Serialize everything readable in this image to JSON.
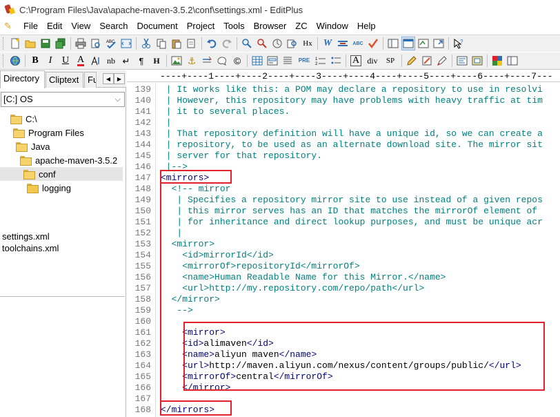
{
  "window": {
    "title": "C:\\Program Files\\Java\\apache-maven-3.5.2\\conf\\settings.xml - EditPlus"
  },
  "menu": [
    "File",
    "Edit",
    "View",
    "Search",
    "Document",
    "Project",
    "Tools",
    "Browser",
    "ZC",
    "Window",
    "Help"
  ],
  "toolbar2": {
    "bold": "B",
    "italic": "I",
    "underline": "U",
    "font_color": "A",
    "nbsp": "nb",
    "break": "↵",
    "paragraph": "¶",
    "heading": "H",
    "anchor": "⚓",
    "copyright": "©",
    "pre": "PRE",
    "a_tag": "A",
    "div": "div",
    "span": "SP"
  },
  "toolbar1": {
    "hex": "Hx",
    "abc": "ABC",
    "word_wrap": "W"
  },
  "left_panel": {
    "tabs": [
      "Directory",
      "Cliptext",
      "Fu"
    ],
    "drive": "[C:] OS",
    "tree": [
      "C:\\",
      "Program Files",
      "Java",
      "apache-maven-3.5.2",
      "conf",
      "logging"
    ],
    "selected_folder": "conf",
    "files": [
      "settings.xml",
      "toolchains.xml"
    ]
  },
  "editor": {
    "ruler": "----+----1----+----2----+----3----+----4----+----5----+----6----+----7---",
    "lines": [
      {
        "n": "139",
        "text": " | It works like this: a POM may declare a repository to use in resolvi",
        "kind": "comment"
      },
      {
        "n": "140",
        "text": " | However, this repository may have problems with heavy traffic at tim",
        "kind": "comment"
      },
      {
        "n": "141",
        "text": " | it to several places.",
        "kind": "comment"
      },
      {
        "n": "142",
        "text": " |",
        "kind": "comment"
      },
      {
        "n": "143",
        "text": " | That repository definition will have a unique id, so we can create a",
        "kind": "comment"
      },
      {
        "n": "144",
        "text": " | repository, to be used as an alternate download site. The mirror sit",
        "kind": "comment"
      },
      {
        "n": "145",
        "text": " | server for that repository.",
        "kind": "comment"
      },
      {
        "n": "146",
        "text": " |-->",
        "kind": "comment"
      },
      {
        "n": "147",
        "text": "<mirrors>",
        "kind": "tag"
      },
      {
        "n": "148",
        "text": "  <!-- mirror",
        "kind": "comment"
      },
      {
        "n": "149",
        "text": "   | Specifies a repository mirror site to use instead of a given repos",
        "kind": "comment"
      },
      {
        "n": "150",
        "text": "   | this mirror serves has an ID that matches the mirrorOf element of",
        "kind": "comment"
      },
      {
        "n": "151",
        "text": "   | for inheritance and direct lookup purposes, and must be unique acr",
        "kind": "comment"
      },
      {
        "n": "152",
        "text": "   |",
        "kind": "comment"
      },
      {
        "n": "153",
        "text": "  <mirror>",
        "kind": "comment"
      },
      {
        "n": "154",
        "text": "    <id>mirrorId</id>",
        "kind": "comment"
      },
      {
        "n": "155",
        "text": "    <mirrorOf>repositoryId</mirrorOf>",
        "kind": "comment"
      },
      {
        "n": "156",
        "text": "    <name>Human Readable Name for this Mirror.</name>",
        "kind": "comment"
      },
      {
        "n": "157",
        "text": "    <url>http://my.repository.com/repo/path</url>",
        "kind": "comment"
      },
      {
        "n": "158",
        "text": "  </mirror>",
        "kind": "comment"
      },
      {
        "n": "159",
        "text": "   -->",
        "kind": "comment"
      },
      {
        "n": "160",
        "text": "",
        "kind": "plain"
      },
      {
        "n": "161",
        "text": "    <mirror>",
        "kind": "tag"
      },
      {
        "n": "162",
        "text": "    <id>alimaven</id>",
        "kind": "mixed",
        "parts": [
          [
            "tag",
            "    <id>"
          ],
          [
            "text",
            "alimaven"
          ],
          [
            "tag",
            "</id>"
          ]
        ]
      },
      {
        "n": "163",
        "text": "    <name>aliyun maven</name>",
        "kind": "mixed",
        "parts": [
          [
            "tag",
            "    <name>"
          ],
          [
            "text",
            "aliyun maven"
          ],
          [
            "tag",
            "</name>"
          ]
        ]
      },
      {
        "n": "164",
        "text": "    <url>http://maven.aliyun.com/nexus/content/groups/public/</url>",
        "kind": "mixed",
        "parts": [
          [
            "tag",
            "    <url>"
          ],
          [
            "text",
            "http://maven.aliyun.com/nexus/content/groups/public/"
          ],
          [
            "tag",
            "</url>"
          ]
        ]
      },
      {
        "n": "165",
        "text": "    <mirrorOf>central</mirrorOf>",
        "kind": "mixed",
        "parts": [
          [
            "tag",
            "    <mirrorOf>"
          ],
          [
            "text",
            "central"
          ],
          [
            "tag",
            "</mirrorOf>"
          ]
        ]
      },
      {
        "n": "166",
        "text": "    </mirror>",
        "kind": "tag"
      },
      {
        "n": "167",
        "text": "",
        "kind": "plain"
      },
      {
        "n": "168",
        "text": "</mirrors>",
        "kind": "tag"
      }
    ]
  },
  "colors": {
    "comment": "#008080",
    "tag": "#000080",
    "highlight_box": "#e0202a"
  }
}
